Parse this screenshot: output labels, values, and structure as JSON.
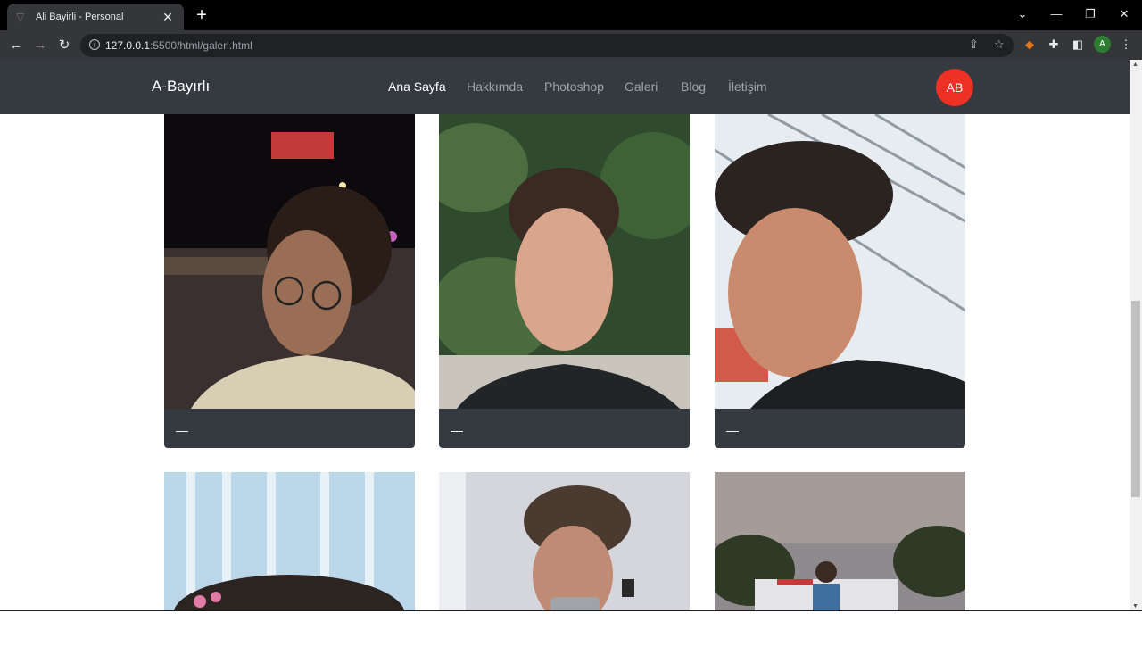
{
  "browser": {
    "tab_title": "Ali Bayirli - Personal",
    "url_host": "127.0.0.1",
    "url_rest": ":5500/html/galeri.html",
    "profile_initial": "A"
  },
  "site": {
    "brand": "A-Bayırlı",
    "nav": [
      "Ana Sayfa",
      "Hakkımda",
      "Photoshop",
      "Galeri",
      "Blog",
      "İletişim"
    ],
    "active_nav": "Ana Sayfa",
    "avatar_initials": "AB",
    "avatar_color": "#ee3124"
  },
  "gallery": {
    "captions": [
      "—",
      "—",
      "—"
    ]
  }
}
